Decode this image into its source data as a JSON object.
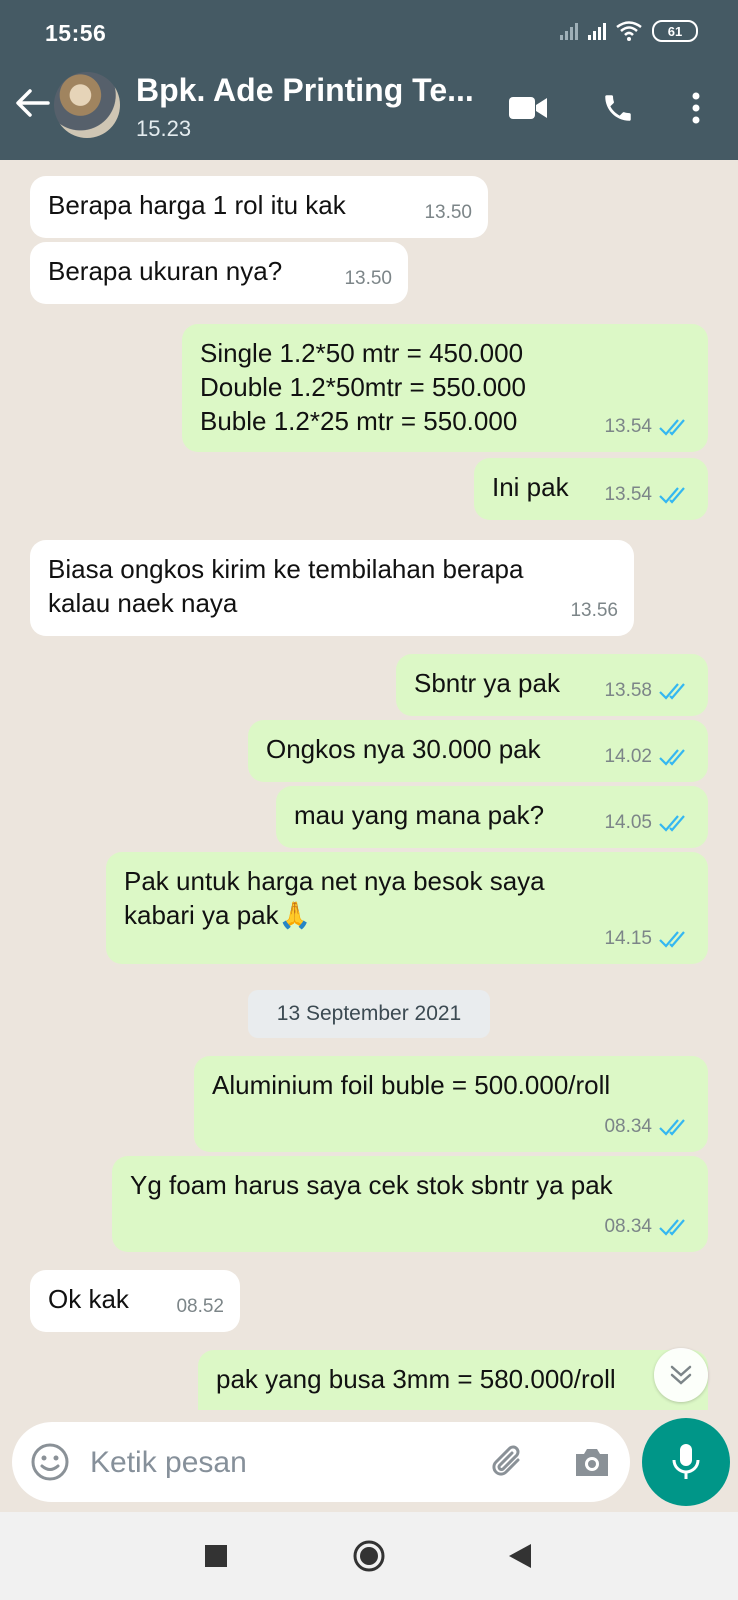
{
  "status_bar": {
    "time": "15:56",
    "battery": "61"
  },
  "header": {
    "contact_name": "Bpk. Ade Printing Te...",
    "contact_status": "15.23"
  },
  "messages": [
    {
      "dir": "in",
      "text": "Berapa harga 1 rol itu kak",
      "time": "13.50"
    },
    {
      "dir": "in",
      "text": "Berapa ukuran nya?",
      "time": "13.50"
    },
    {
      "dir": "out",
      "text": "Single 1.2*50 mtr = 450.000\nDouble 1.2*50mtr = 550.000\nBuble 1.2*25 mtr = 550.000",
      "time": "13.54"
    },
    {
      "dir": "out",
      "text": "Ini pak",
      "time": "13.54"
    },
    {
      "dir": "in",
      "text": "Biasa ongkos kirim ke tembilahan berapa\nkalau naek naya",
      "time": "13.56"
    },
    {
      "dir": "out",
      "text": "Sbntr ya pak",
      "time": "13.58"
    },
    {
      "dir": "out",
      "text": "Ongkos nya 30.000 pak",
      "time": "14.02"
    },
    {
      "dir": "out",
      "text": "mau yang mana pak?",
      "time": "14.05"
    },
    {
      "dir": "out",
      "text": "Pak untuk harga net nya besok saya\nkabari ya pak🙏",
      "time": "14.15"
    },
    {
      "dir": "out",
      "text": "Aluminium foil buble = 500.000/roll",
      "time": "08.34"
    },
    {
      "dir": "out",
      "text": "Yg foam harus saya cek stok sbntr ya pak",
      "time": "08.34"
    },
    {
      "dir": "in",
      "text": "Ok kak",
      "time": "08.52"
    },
    {
      "dir": "out",
      "text": "pak yang busa 3mm = 580.000/roll",
      "time": ""
    }
  ],
  "date_divider": "13 September 2021",
  "input": {
    "placeholder": "Ketik pesan"
  },
  "colors": {
    "header": "#455a64",
    "outgoing": "#dcf8c6",
    "incoming": "#ffffff",
    "accent": "#009688",
    "ticks": "#34b7f1"
  },
  "icons": {
    "back": "arrow-left-icon",
    "video": "video-call-icon",
    "call": "phone-icon",
    "menu": "more-vert-icon",
    "emoji": "emoji-icon",
    "attach": "paperclip-icon",
    "camera": "camera-icon",
    "mic": "mic-icon",
    "scroll": "chevrons-down-icon",
    "nav_recent": "square-icon",
    "nav_home": "circle-icon",
    "nav_back": "triangle-icon"
  }
}
